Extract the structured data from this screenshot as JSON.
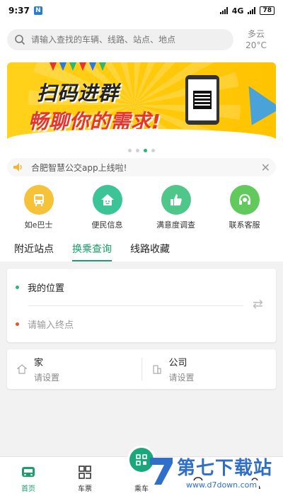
{
  "status": {
    "time": "9:37",
    "network": "4G",
    "battery": "78"
  },
  "search": {
    "placeholder": "请输入查找的车辆、线路、站点、地点"
  },
  "weather": {
    "condition": "多云",
    "temp": "20°C"
  },
  "banner": {
    "line1": "扫码进群",
    "line2": "畅聊你的需求!"
  },
  "notice": {
    "text": "合肥智慧公交app上线啦!"
  },
  "quick": [
    {
      "label": "如e巴士",
      "color": "#f6c23a",
      "icon": "bus-icon"
    },
    {
      "label": "便民信息",
      "color": "#3cc497",
      "icon": "home-icon"
    },
    {
      "label": "满意度调查",
      "color": "#4fc78a",
      "icon": "thumbs-up-icon"
    },
    {
      "label": "联系客服",
      "color": "#62c95d",
      "icon": "headset-icon"
    }
  ],
  "tabs": [
    "附近站点",
    "换乘查询",
    "线路收藏"
  ],
  "route": {
    "from": "我的位置",
    "to_placeholder": "请输入终点"
  },
  "places": [
    {
      "name": "家",
      "hint": "请设置"
    },
    {
      "name": "公司",
      "hint": "请设置"
    }
  ],
  "nav": [
    {
      "label": "首页"
    },
    {
      "label": "车票"
    },
    {
      "label": "乘车"
    },
    {
      "label": ""
    },
    {
      "label": ""
    }
  ],
  "watermark": {
    "name": "第七下载站",
    "url": "www.d7down.com"
  },
  "colors": {
    "accent": "#1a9e6a"
  }
}
